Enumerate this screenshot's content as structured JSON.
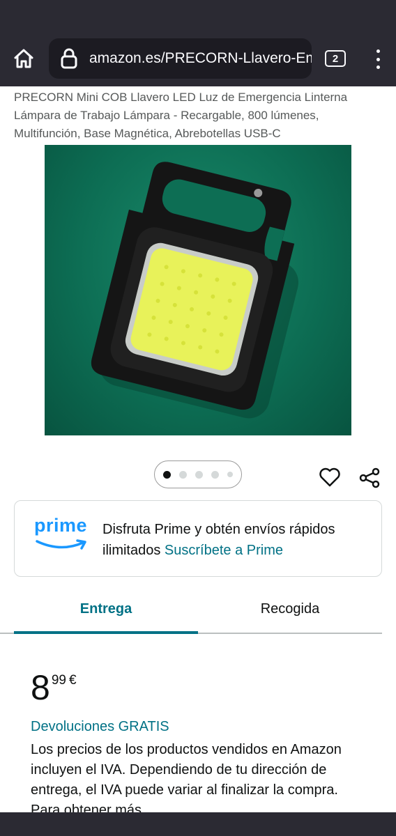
{
  "browser": {
    "url": "amazon.es/PRECORN-Llavero-Emergencia",
    "tab_count": "2",
    "icons": [
      "home-icon",
      "lock-icon",
      "tabs-icon",
      "menu-icon"
    ]
  },
  "product": {
    "title": "PRECORN Mini COB Llavero LED Luz de Emergencia Linterna Lámpara de Trabajo Lámpara - Recargable, 800 lúmenes, Multifunción, Base Magnética, Abrebotellas USB-C",
    "image_count": 5,
    "active_image_index": 0
  },
  "prime": {
    "logo_text": "prime",
    "message": "Disfruta Prime y obtén envíos rápidos ilimitados",
    "link": "Suscríbete a Prime"
  },
  "delivery_tabs": {
    "entrega": "Entrega",
    "recogida": "Recogida",
    "selected": "Entrega"
  },
  "price": {
    "whole": "8",
    "fraction": "99",
    "currency": "€"
  },
  "returns": "Devoluciones GRATIS",
  "vat_note": "Los precios de los productos vendidos en Amazon incluyen el IVA. Dependiendo de tu dirección de entrega, el IVA puede variar al finalizar la compra. Para obtener más",
  "colors": {
    "browser_chrome": "#2b2a33",
    "link_teal": "#007185",
    "prime_blue": "#1a98ff"
  }
}
